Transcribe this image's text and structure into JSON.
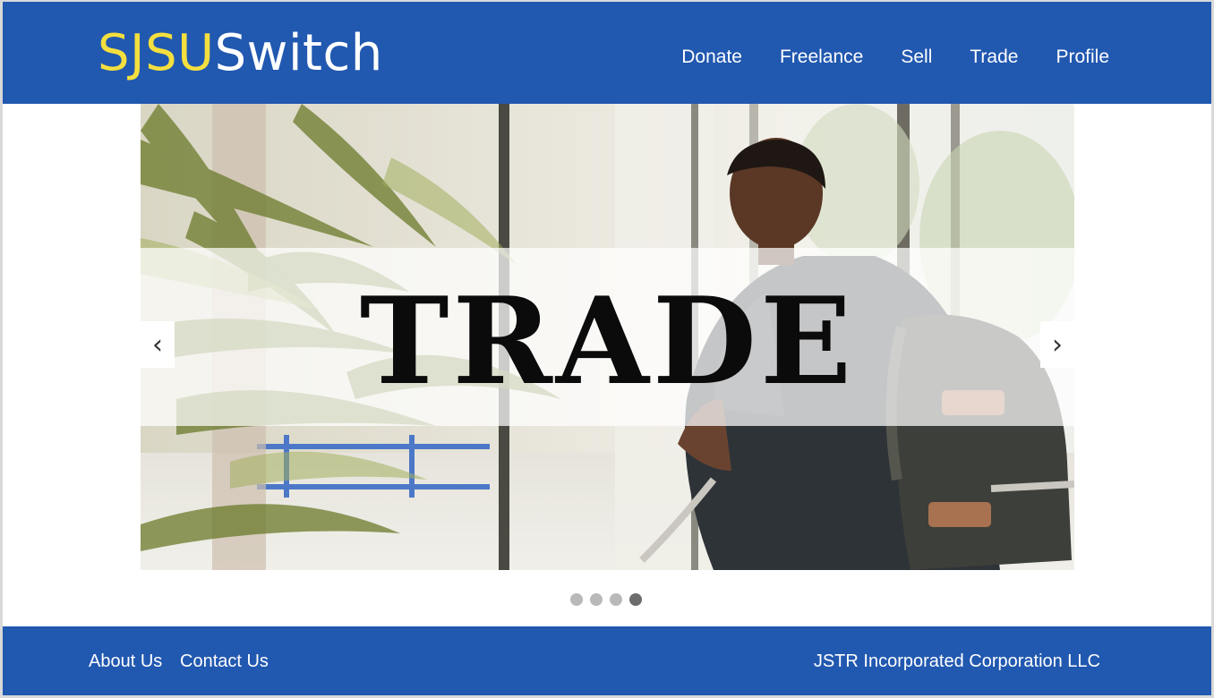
{
  "header": {
    "logo_part1": "SJSU",
    "logo_part2": "Switch",
    "nav": [
      "Donate",
      "Freelance",
      "Sell",
      "Trade",
      "Profile"
    ]
  },
  "carousel": {
    "slide_title": "TRADE",
    "prev_icon": "‹",
    "next_icon": "›",
    "slide_count": 4,
    "active_slide": 4
  },
  "footer": {
    "about": "About Us",
    "contact": "Contact Us",
    "company": "JSTR Incorporated Corporation LLC"
  },
  "colors": {
    "brand_blue": "#2158b0",
    "logo_yellow": "#f4df3e"
  }
}
